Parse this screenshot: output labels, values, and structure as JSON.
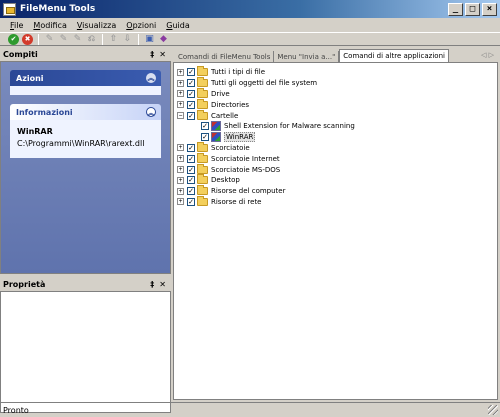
{
  "window": {
    "title": "FileMenu Tools"
  },
  "menu": [
    "File",
    "Modifica",
    "Visualizza",
    "Opzioni",
    "Guida"
  ],
  "left": {
    "tasks_title": "Compiti",
    "actions_title": "Azioni",
    "info_title": "Informazioni",
    "info_name": "WinRAR",
    "info_path": "C:\\Programmi\\WinRAR\\rarext.dll",
    "properties_title": "Proprietà",
    "pin": "‡",
    "close": "✕"
  },
  "tabs": [
    "Comandi di FileMenu Tools",
    "Menu \"Invia a...\"",
    "Comandi di altre applicazioni"
  ],
  "tab_arrows": "◁ ▷",
  "tree": {
    "before": [
      "Tutti i tipi di file",
      "Tutti gli oggetti del file system",
      "Drive",
      "Directories",
      "Cartelle"
    ],
    "children": [
      "Shell Extension for Malware scanning",
      "WinRAR"
    ],
    "after": [
      "Scorciatoie",
      "Scorciatoie Internet",
      "Scorciatoie MS-DOS",
      "Desktop",
      "Risorse del computer",
      "Risorse di rete"
    ]
  },
  "status": "Pronto"
}
